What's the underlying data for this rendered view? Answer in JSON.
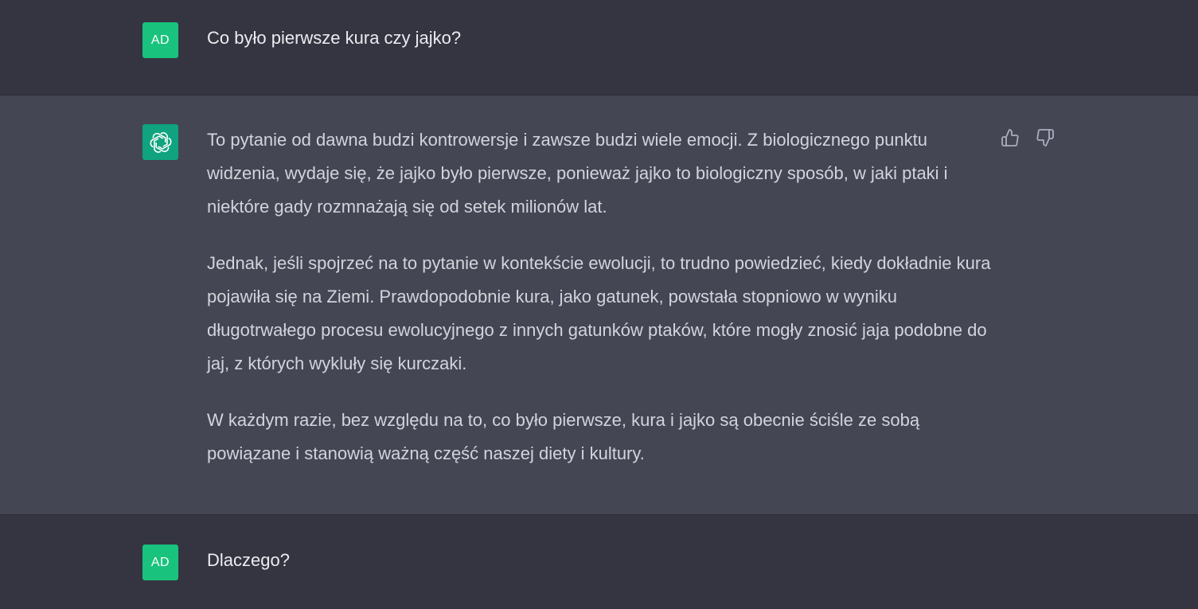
{
  "conversation": {
    "messages": [
      {
        "role": "user",
        "avatar": "AD",
        "text": "Co było pierwsze kura czy jajko?"
      },
      {
        "role": "assistant",
        "avatar_icon": "openai-logo-icon",
        "paragraphs": [
          "To pytanie od dawna budzi kontrowersje i zawsze budzi wiele emocji. Z biologicznego punktu widzenia, wydaje się, że jajko było pierwsze, ponieważ jajko to biologiczny sposób, w jaki ptaki i niektóre gady rozmnażają się od setek milionów lat.",
          "Jednak, jeśli spojrzeć na to pytanie w kontekście ewolucji, to trudno powiedzieć, kiedy dokładnie kura pojawiła się na Ziemi. Prawdopodobnie kura, jako gatunek, powstała stopniowo w wyniku długotrwałego procesu ewolucyjnego z innych gatunków ptaków, które mogły znosić jaja podobne do jaj, z których wykluły się kurczaki.",
          "W każdym razie, bez względu na to, co było pierwsze, kura i jajko są obecnie ściśle ze sobą powiązane i stanowią ważną część naszej diety i kultury."
        ],
        "feedback_icons": [
          "thumbs-up-icon",
          "thumbs-down-icon"
        ]
      },
      {
        "role": "user",
        "avatar": "AD",
        "text": "Dlaczego?"
      }
    ]
  },
  "colors": {
    "user_bg": "#343541",
    "assistant_bg": "#444654",
    "user_avatar": "#19c37d",
    "assistant_avatar": "#10a37f",
    "text": "#d1d5db",
    "icon": "#acacbe"
  }
}
